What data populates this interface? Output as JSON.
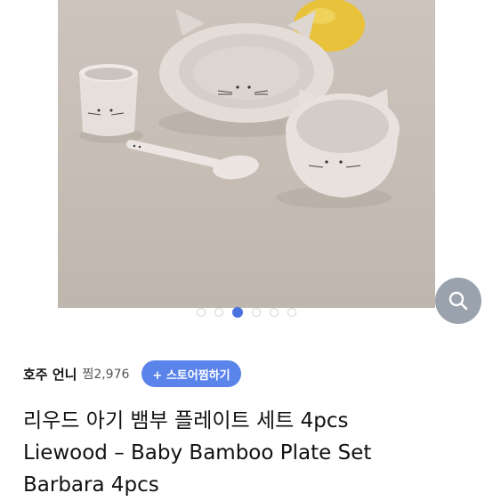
{
  "product_image": {
    "alt_icon": "product-photo",
    "carousel": {
      "count": 6,
      "active_index": 2
    }
  },
  "zoom_button": {
    "icon": "magnifier-icon"
  },
  "seller": {
    "name": "호주 언니",
    "wish_count": "찜2,976",
    "store_button_label": "+ 스토어찜하기"
  },
  "product": {
    "title_line1": "리우드 아기 뱀부 플레이트 세트 4pcs",
    "title_line2": "Liewood – Baby Bamboo Plate Set",
    "title_line3": "Barbara 4pcs"
  }
}
